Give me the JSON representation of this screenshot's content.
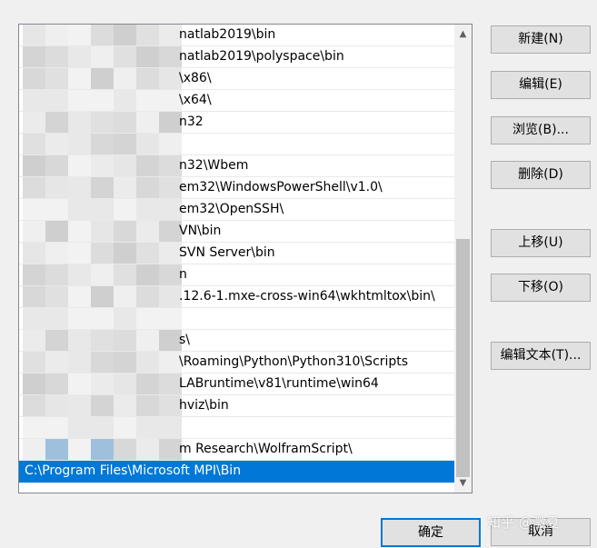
{
  "path_list": {
    "items": [
      "natlab2019\\bin",
      "natlab2019\\polyspace\\bin",
      "\\x86\\",
      "\\x64\\",
      "n32",
      "",
      "n32\\Wbem",
      "em32\\WindowsPowerShell\\v1.0\\",
      "em32\\OpenSSH\\",
      "VN\\bin",
      "SVN Server\\bin",
      "n",
      ".12.6-1.mxe-cross-win64\\wkhtmltox\\bin\\",
      "",
      "s\\",
      "\\Roaming\\Python\\Python310\\Scripts",
      "LABruntime\\v81\\runtime\\win64",
      "hviz\\bin",
      "",
      "m Research\\WolframScript\\",
      "C:\\Program Files\\Microsoft MPI\\Bin"
    ],
    "selected_index": 20
  },
  "buttons": {
    "new": "新建(N)",
    "edit": "编辑(E)",
    "browse": "浏览(B)...",
    "delete": "删除(D)",
    "move_up": "上移(U)",
    "move_down": "下移(O)",
    "edit_text": "编辑文本(T)...",
    "ok": "确定",
    "cancel": "取消"
  },
  "watermark": "知乎 @澂夏",
  "colors": {
    "selection": "#0078d7",
    "dialog_bg": "#f0f0f0",
    "button_bg": "#e1e1e1"
  },
  "icons": {
    "scroll_up": "chevron-up-icon",
    "scroll_down": "chevron-down-icon"
  }
}
